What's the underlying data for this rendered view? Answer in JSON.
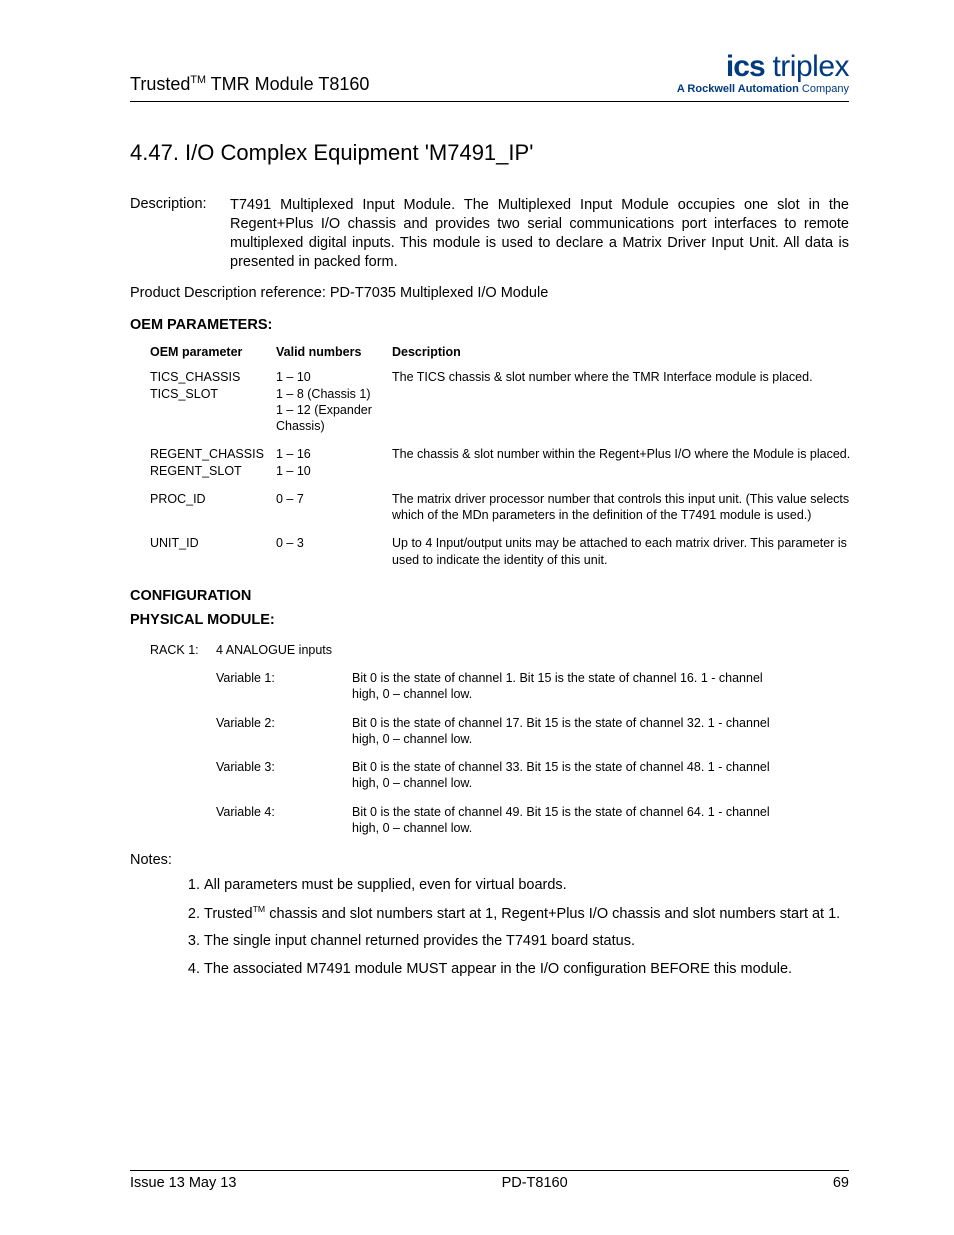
{
  "header": {
    "product_prefix": "Trusted",
    "product_sup": "TM",
    "product_suffix": " TMR Module T8160",
    "logo_bold": "ics",
    "logo_light": " triplex",
    "logo_sub_bold": "A Rockwell Automation ",
    "logo_sub_light": "Company"
  },
  "title": "4.47. I/O Complex Equipment 'M7491_IP'",
  "description": {
    "label": "Description:",
    "text": "T7491 Multiplexed Input Module.  The Multiplexed Input Module occupies one slot in the Regent+Plus I/O chassis and provides two serial communications port interfaces to remote multiplexed digital inputs. This module is used to declare a Matrix Driver Input Unit. All data is presented in packed form."
  },
  "ref_line": "Product Description reference: PD-T7035  Multiplexed I/O Module",
  "oem": {
    "heading": "OEM PARAMETERS:",
    "headers": {
      "param": "OEM parameter",
      "valid": "Valid numbers",
      "desc": "Description"
    },
    "rows": [
      {
        "param": "TICS_CHASSIS TICS_SLOT",
        "valid": "1 – 10\n1 – 8 (Chassis 1)\n1 – 12 (Expander Chassis)",
        "desc": "The TICS chassis & slot number where the TMR Interface module is placed."
      },
      {
        "param": "REGENT_CHASSIS REGENT_SLOT",
        "valid": "1 – 16\n1 – 10",
        "desc": "The chassis & slot number within the Regent+Plus I/O where the Module is placed."
      },
      {
        "param": "PROC_ID",
        "valid": "0 – 7",
        "desc": "The matrix driver processor number that controls this input unit. (This value selects which of the MDn parameters in the definition of the T7491 module is used.)"
      },
      {
        "param": "UNIT_ID",
        "valid": "0 – 3",
        "desc": "Up to 4 Input/output units may be attached to each matrix driver. This parameter is used to indicate the identity of this unit."
      }
    ]
  },
  "config": {
    "heading": "CONFIGURATION",
    "phys_heading": "PHYSICAL MODULE:",
    "rack_label": "RACK 1:",
    "rack_desc": "4 ANALOGUE inputs",
    "vars": [
      {
        "label": "Variable 1:",
        "desc": "Bit 0 is the state of channel 1.  Bit 15 is the state of channel 16. 1 - channel high, 0 – channel low."
      },
      {
        "label": "Variable 2:",
        "desc": "Bit 0 is the state of channel 17.  Bit 15 is the state of channel 32. 1 - channel high, 0 – channel low."
      },
      {
        "label": "Variable 3:",
        "desc": "Bit 0 is the state of channel 33.  Bit 15 is the state of channel 48. 1 - channel high, 0 – channel low."
      },
      {
        "label": "Variable 4:",
        "desc": "Bit 0 is the state of channel 49.  Bit 15 is the state of channel 64. 1 - channel high, 0 – channel low."
      }
    ]
  },
  "notes": {
    "label": "Notes:",
    "items": [
      {
        "pre": "All parameters must be supplied, even for virtual boards.",
        "sup": "",
        "post": ""
      },
      {
        "pre": "Trusted",
        "sup": "TM",
        "post": " chassis and slot numbers start at 1, Regent+Plus I/O chassis and slot numbers start at 1."
      },
      {
        "pre": "The single input channel returned provides the T7491 board status.",
        "sup": "",
        "post": ""
      },
      {
        "pre": "The associated M7491 module MUST appear in the I/O configuration BEFORE this module.",
        "sup": "",
        "post": ""
      }
    ]
  },
  "footer": {
    "left": "Issue 13 May 13",
    "center": "PD-T8160",
    "right": "69"
  }
}
